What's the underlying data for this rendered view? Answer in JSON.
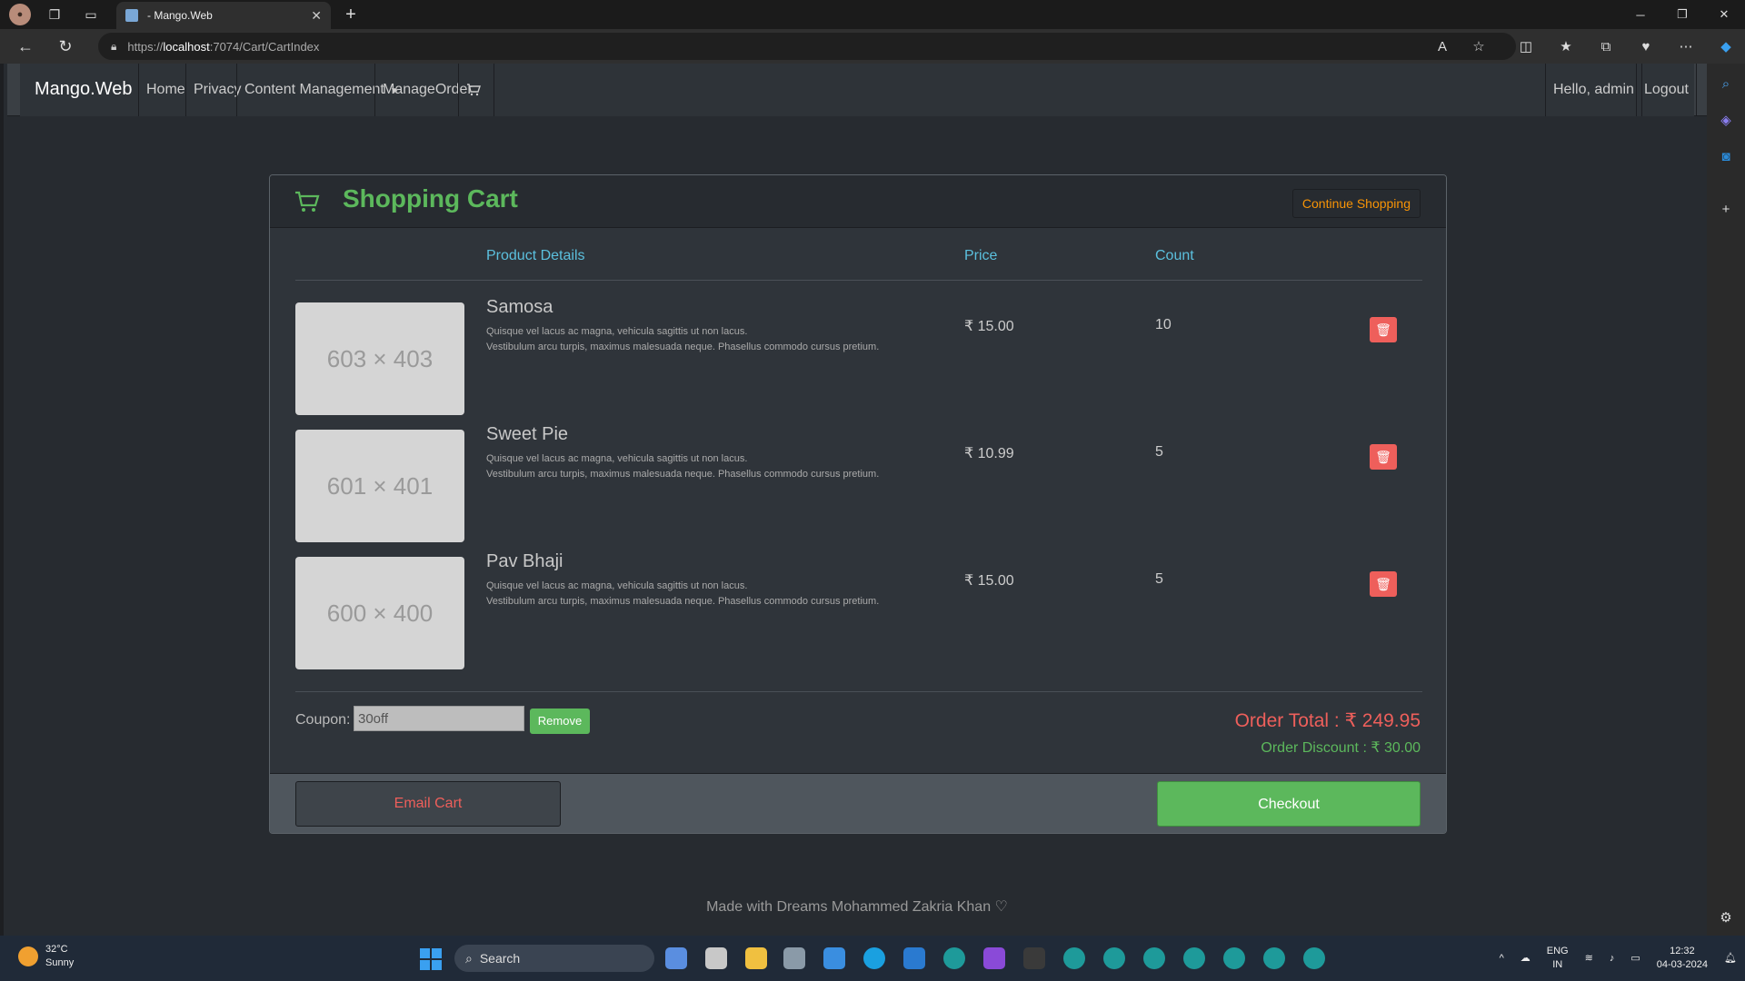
{
  "browser": {
    "tab_title": "- Mango.Web",
    "url_prefix": "https://",
    "url_host": "localhost",
    "url_rest": ":7074/Cart/CartIndex"
  },
  "navbar": {
    "brand": "Mango.Web",
    "links": [
      "Home",
      "Privacy",
      "Content Management",
      "ManageOrder"
    ],
    "greeting": "Hello, admin",
    "logout": "Logout"
  },
  "cart": {
    "title": "Shopping Cart",
    "continue_label": "Continue Shopping",
    "columns": {
      "details": "Product Details",
      "price": "Price",
      "count": "Count"
    },
    "items": [
      {
        "image_label": "603 × 403",
        "name": "Samosa",
        "desc1": "Quisque vel lacus ac magna, vehicula sagittis ut non lacus.",
        "desc2": "Vestibulum arcu turpis, maximus malesuada neque. Phasellus commodo cursus pretium.",
        "price": "₹ 15.00",
        "count": "10"
      },
      {
        "image_label": "601 × 401",
        "name": "Sweet Pie",
        "desc1": "Quisque vel lacus ac magna, vehicula sagittis ut non lacus.",
        "desc2": "Vestibulum arcu turpis, maximus malesuada neque. Phasellus commodo cursus pretium.",
        "price": "₹ 10.99",
        "count": "5"
      },
      {
        "image_label": "600 × 400",
        "name": "Pav Bhaji",
        "desc1": "Quisque vel lacus ac magna, vehicula sagittis ut non lacus.",
        "desc2": "Vestibulum arcu turpis, maximus malesuada neque. Phasellus commodo cursus pretium.",
        "price": "₹ 15.00",
        "count": "5"
      }
    ],
    "coupon_label": "Coupon:",
    "coupon_value": "30off",
    "remove_label": "Remove",
    "order_total": "Order Total : ₹ 249.95",
    "order_discount": "Order Discount : ₹ 30.00",
    "email_label": "Email Cart",
    "checkout_label": "Checkout"
  },
  "footer": {
    "text": "Made with Dreams Mohammed Zakria Khan ♡"
  },
  "taskbar": {
    "temp": "32°C",
    "condition": "Sunny",
    "search_label": "Search",
    "lang1": "ENG",
    "lang2": "IN",
    "time": "12:32",
    "date": "04-03-2024"
  },
  "colors": {
    "accent_green": "#5cb85c",
    "accent_red": "#ee5f5b",
    "accent_cyan": "#5bc0de",
    "accent_orange": "#f89406"
  }
}
